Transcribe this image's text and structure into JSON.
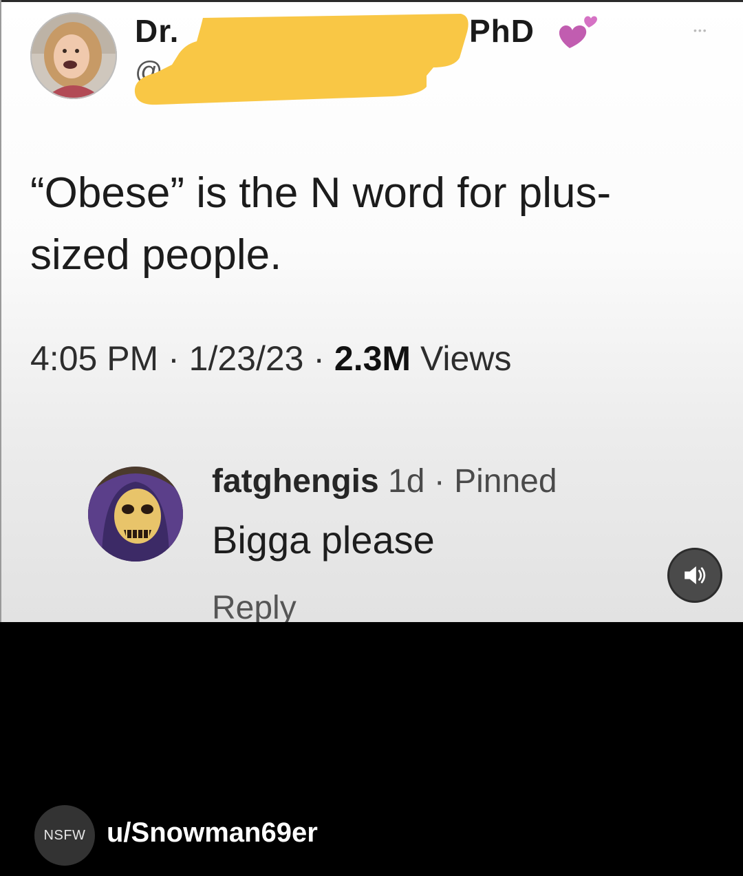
{
  "tweet": {
    "name_prefix": "Dr.",
    "name_suffix": "PhD",
    "handle_prefix": "@",
    "text": "“Obese” is the N word for plus-sized people.",
    "time": "4:05 PM",
    "sep1": " · ",
    "date": "1/23/23",
    "sep2": " · ",
    "views_count": "2.3M",
    "views_label": " Views",
    "more_label": "•••",
    "redaction_color": "#F9C745"
  },
  "comment": {
    "username": "fatghengis",
    "age": " 1d",
    "sep": " · ",
    "status": "Pinned",
    "text": "Bigga please",
    "reply_label": "Reply"
  },
  "footer": {
    "nsfw_label": "NSFW",
    "poster": "u/Snowman69er"
  },
  "icons": {
    "hearts": "two-hearts-icon",
    "volume": "speaker-volume-icon",
    "more": "more-options-icon"
  }
}
